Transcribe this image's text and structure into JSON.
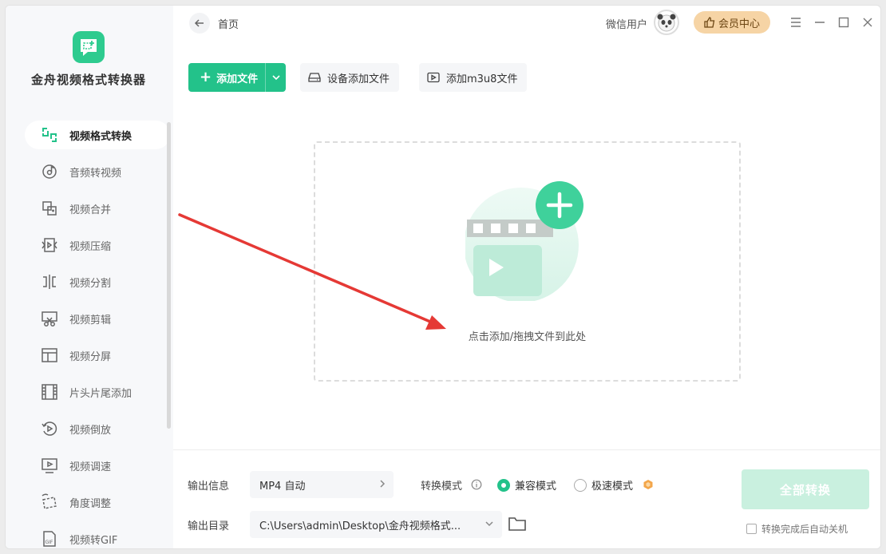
{
  "app": {
    "name": "金舟视频格式转换器"
  },
  "sidebar": {
    "items": [
      {
        "label": "视频格式转换",
        "icon": "swap-format-icon",
        "active": true
      },
      {
        "label": "音频转视频",
        "icon": "music-disc-icon",
        "active": false
      },
      {
        "label": "视频合并",
        "icon": "merge-icon",
        "active": false
      },
      {
        "label": "视频压缩",
        "icon": "compress-icon",
        "active": false
      },
      {
        "label": "视频分割",
        "icon": "split-icon",
        "active": false
      },
      {
        "label": "视频剪辑",
        "icon": "scissors-icon",
        "active": false
      },
      {
        "label": "视频分屏",
        "icon": "layout-split-icon",
        "active": false
      },
      {
        "label": "片头片尾添加",
        "icon": "film-strip-icon",
        "active": false
      },
      {
        "label": "视频倒放",
        "icon": "rewind-icon",
        "active": false
      },
      {
        "label": "视频调速",
        "icon": "speed-icon",
        "active": false
      },
      {
        "label": "角度调整",
        "icon": "rotate-icon",
        "active": false
      },
      {
        "label": "视频转GIF",
        "icon": "gif-icon",
        "active": false
      }
    ]
  },
  "header": {
    "breadcrumb": "首页",
    "user_name": "微信用户",
    "vip_label": "会员中心"
  },
  "toolbar": {
    "add_file": "添加文件",
    "device_add": "设备添加文件",
    "add_m3u8": "添加m3u8文件"
  },
  "dropzone": {
    "hint": "点击添加/拖拽文件到此处"
  },
  "bottom": {
    "output_info_label": "输出信息",
    "output_format": "MP4 自动",
    "mode_label": "转换模式",
    "mode_compat": "兼容模式",
    "mode_fast": "极速模式",
    "output_dir_label": "输出目录",
    "output_dir": "C:\\Users\\admin\\Desktop\\金舟视频格式...",
    "convert_all": "全部转换",
    "auto_shutdown": "转换完成后自动关机"
  },
  "colors": {
    "accent": "#23c28a",
    "vip": "#f6d4a5",
    "annotation_arrow": "#e53935"
  }
}
